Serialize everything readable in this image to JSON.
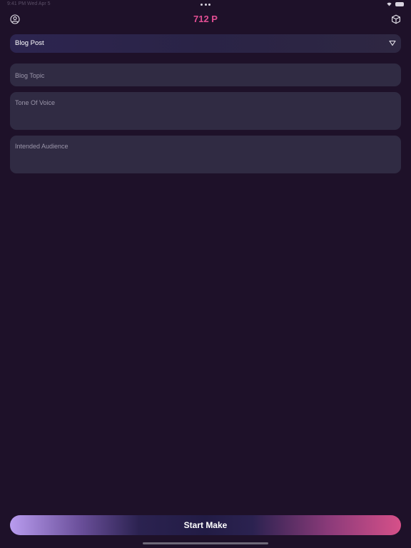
{
  "status_bar": {
    "left_text": "9:41 PM  Wed Apr 5",
    "battery_icon": "battery-icon",
    "wifi_icon": "wifi-icon"
  },
  "nav": {
    "title": "712 P",
    "title_color": "#e24e93",
    "left_icon": "profile-circle-icon",
    "right_icon": "cube-icon"
  },
  "form": {
    "content_type": {
      "selected": "Blog Post",
      "icon": "chevron-down-icon"
    },
    "blog_topic": {
      "value": "",
      "placeholder": "Blog Topic"
    },
    "tone_of_voice": {
      "value": "",
      "placeholder": "Tone Of Voice"
    },
    "intended_audience": {
      "value": "",
      "placeholder": "Intended Audience"
    }
  },
  "actions": {
    "start_label": "Start Make"
  },
  "colors": {
    "background": "#1e1129",
    "field_background": "#302b43",
    "accent_pink": "#d65089",
    "accent_purple": "#b99cef"
  }
}
